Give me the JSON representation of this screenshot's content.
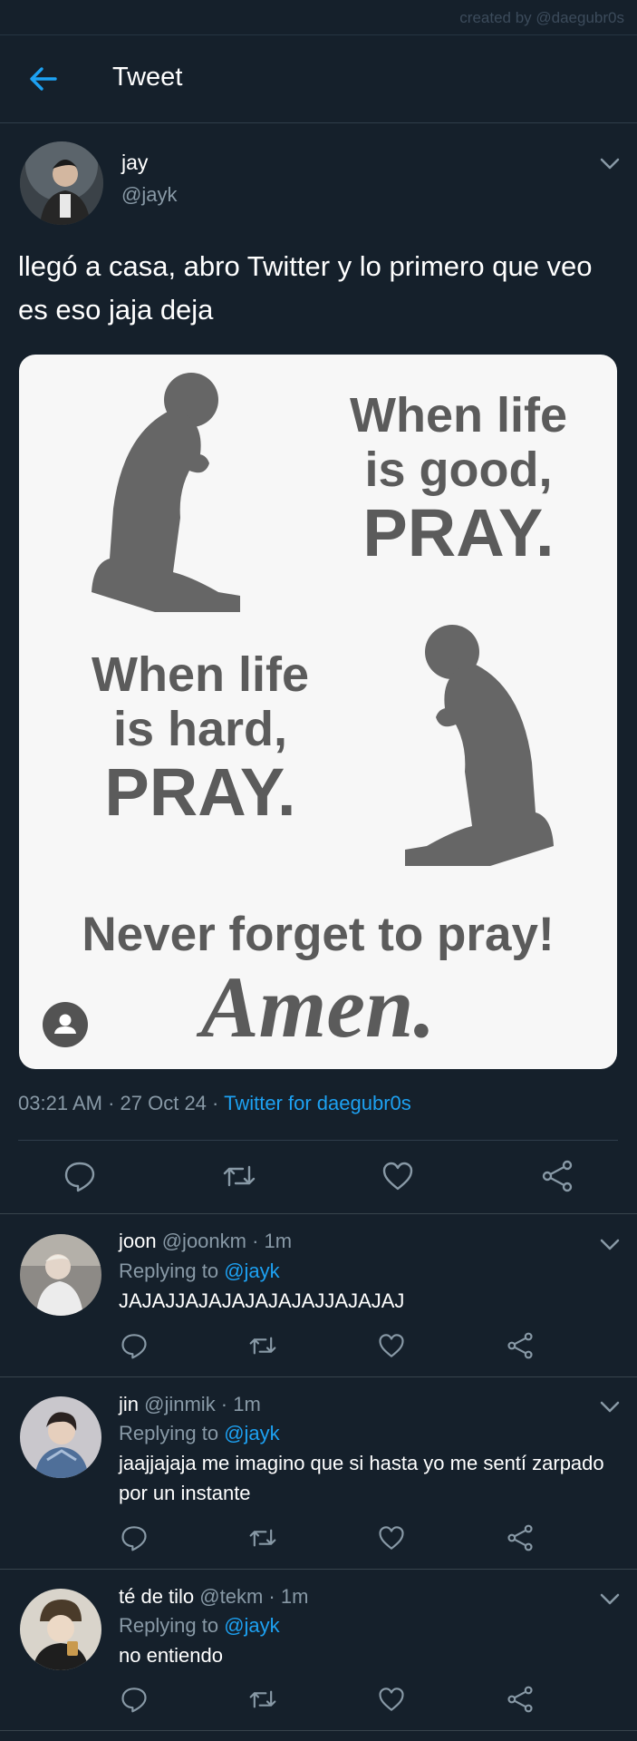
{
  "credit": "created by @daegubr0s",
  "header": {
    "title": "Tweet",
    "back_icon": "arrow-left-icon"
  },
  "tweet": {
    "name": "jay",
    "handle": "@jayk",
    "text": "llegó a casa, abro Twitter y lo primero que veo es eso jaja deja",
    "media": {
      "line1a": "When life",
      "line1b": "is good,",
      "line1c": "PRAY.",
      "line2a": "When life",
      "line2b": "is hard,",
      "line2c": "PRAY.",
      "line3": "Never forget to pray!",
      "line4": "Amen."
    },
    "time": "03:21 AM",
    "sep": "·",
    "date": "27 Oct 24",
    "source": "Twitter for daegubr0s"
  },
  "replies": [
    {
      "name": "joon",
      "meta": "@joonkm · 1m",
      "replying_label": "Replying to",
      "replying_to": "@jayk",
      "text": "JAJAJJAJAJAJAJAJAJJAJAJAJ"
    },
    {
      "name": "jin",
      "meta": "@jinmik · 1m",
      "replying_label": "Replying to",
      "replying_to": "@jayk",
      "text": "jaajjajaja me imagino que si hasta yo me sentí zarpado por un instante"
    },
    {
      "name": "té de tilo",
      "meta": "@tekm · 1m",
      "replying_label": "Replying to",
      "replying_to": "@jayk",
      "text": "no entiendo"
    }
  ],
  "colors": {
    "background": "#15202b",
    "accent": "#1da1f2",
    "muted": "#8899a6",
    "divider": "#38444d"
  },
  "icons": [
    "arrow-left-icon",
    "chevron-down-icon",
    "reply-icon",
    "retweet-icon",
    "like-icon",
    "share-icon",
    "person-icon"
  ]
}
